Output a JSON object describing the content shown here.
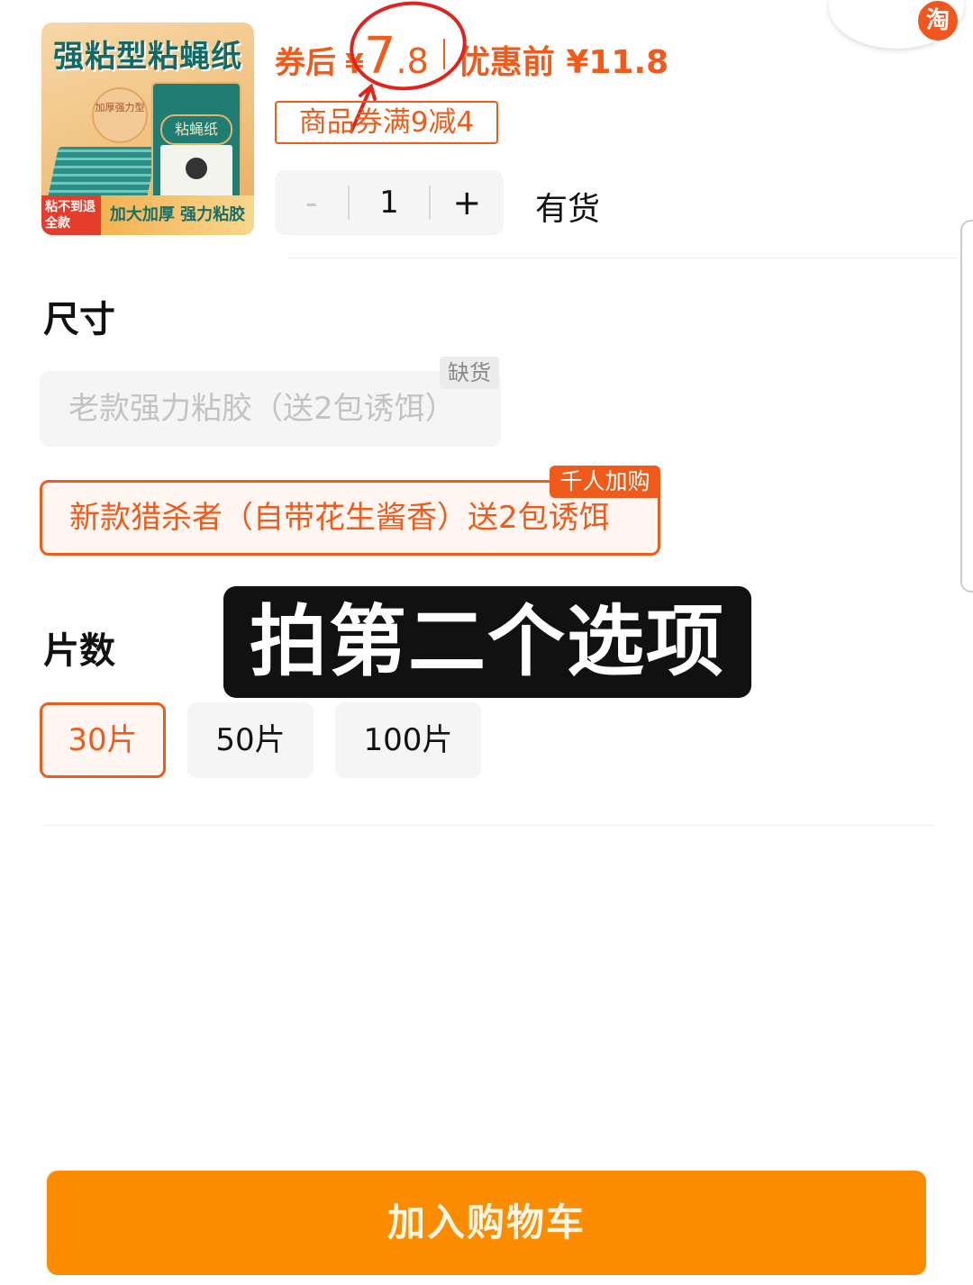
{
  "product": {
    "image": {
      "title": "强粘型粘蝇纸",
      "badge": "加厚强力型",
      "pack_label": "粘蝇纸",
      "strip_left": "粘不到退全款",
      "strip_right": "加大加厚 强力粘胶"
    },
    "price": {
      "after_label": "券后",
      "currency": "¥",
      "integer": "7",
      "decimal": ".8",
      "before_label": "优惠前 ¥11.8"
    },
    "coupon": "商品券满9减4",
    "quantity": {
      "minus": "-",
      "value": "1",
      "plus": "+"
    },
    "stock": "有货"
  },
  "logo": {
    "text": "淘"
  },
  "size_section": {
    "title": "尺寸",
    "options": [
      {
        "label": "老款强力粘胶（送2包诱饵）",
        "tag": "缺货",
        "state": "disabled"
      },
      {
        "label": "新款猎杀者（自带花生酱香）送2包诱饵",
        "tag": "千人加购",
        "state": "selected"
      }
    ]
  },
  "count_section": {
    "title": "片数",
    "options": [
      {
        "label": "30片",
        "state": "selected"
      },
      {
        "label": "50片",
        "state": "normal"
      },
      {
        "label": "100片",
        "state": "normal"
      }
    ]
  },
  "overlay_caption": "拍第二个选项",
  "cart_button": "加入购物车",
  "colors": {
    "accent": "#f05a1a",
    "cart_button": "#fb8c00",
    "annotation_red": "#e0231c"
  }
}
